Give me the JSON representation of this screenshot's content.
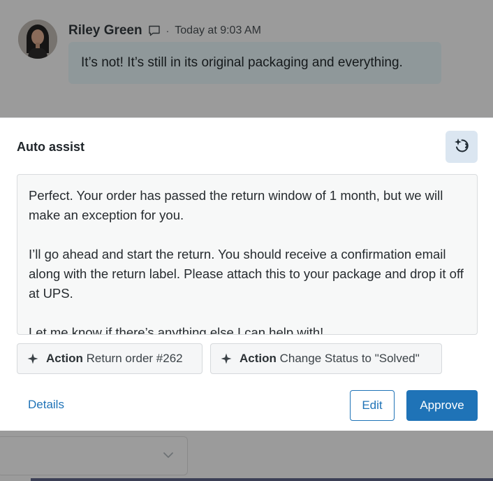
{
  "conversation": {
    "author": "Riley Green",
    "separator": "·",
    "timestamp": "Today at 9:03 AM",
    "message": "It’s not! It’s still in its original packaging and everything.",
    "avatar_icon": "person-avatar",
    "channel_icon": "chat-bubble-icon"
  },
  "auto_assist": {
    "title": "Auto assist",
    "assist_icon": "auto-assist-sparkle-icon",
    "draft_paragraphs": [
      "Perfect. Your order has passed the return window of 1 month, but we will make an exception for you.",
      "I’ll go ahead and start the return. You should receive a confirmation email along with the return label. Please attach this to your package and drop it off at UPS.",
      "Let me know if there’s anything else I can help with!"
    ],
    "actions": [
      {
        "kind": "Action",
        "label": "Return order #262",
        "icon": "sparkle-icon"
      },
      {
        "kind": "Action",
        "label": "Change Status to \"Solved\"",
        "icon": "sparkle-icon"
      }
    ],
    "details_label": "Details",
    "edit_label": "Edit",
    "approve_label": "Approve"
  },
  "colors": {
    "accent": "#1f73b7",
    "assist_button_bg": "#dbe6f1",
    "overlay": "#9b9b9b"
  }
}
